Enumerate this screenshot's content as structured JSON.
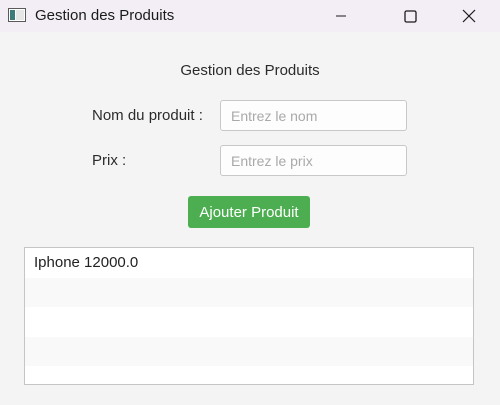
{
  "window": {
    "title": "Gestion des Produits",
    "controls": {
      "minimize": "minimize-icon",
      "maximize": "maximize-icon",
      "close": "close-icon"
    }
  },
  "form": {
    "heading": "Gestion des Produits",
    "name_label": "Nom du produit :",
    "name_value": "",
    "name_placeholder": "Entrez le nom",
    "price_label": "Prix :",
    "price_value": "",
    "price_placeholder": "Entrez le prix",
    "add_button": "Ajouter Produit"
  },
  "product_list": {
    "items": [
      "Iphone 12000.0",
      "",
      "",
      "",
      ""
    ]
  },
  "colors": {
    "accent": "#4cae50",
    "titlebar": "#f3eef5",
    "background": "#f4f4f4"
  }
}
